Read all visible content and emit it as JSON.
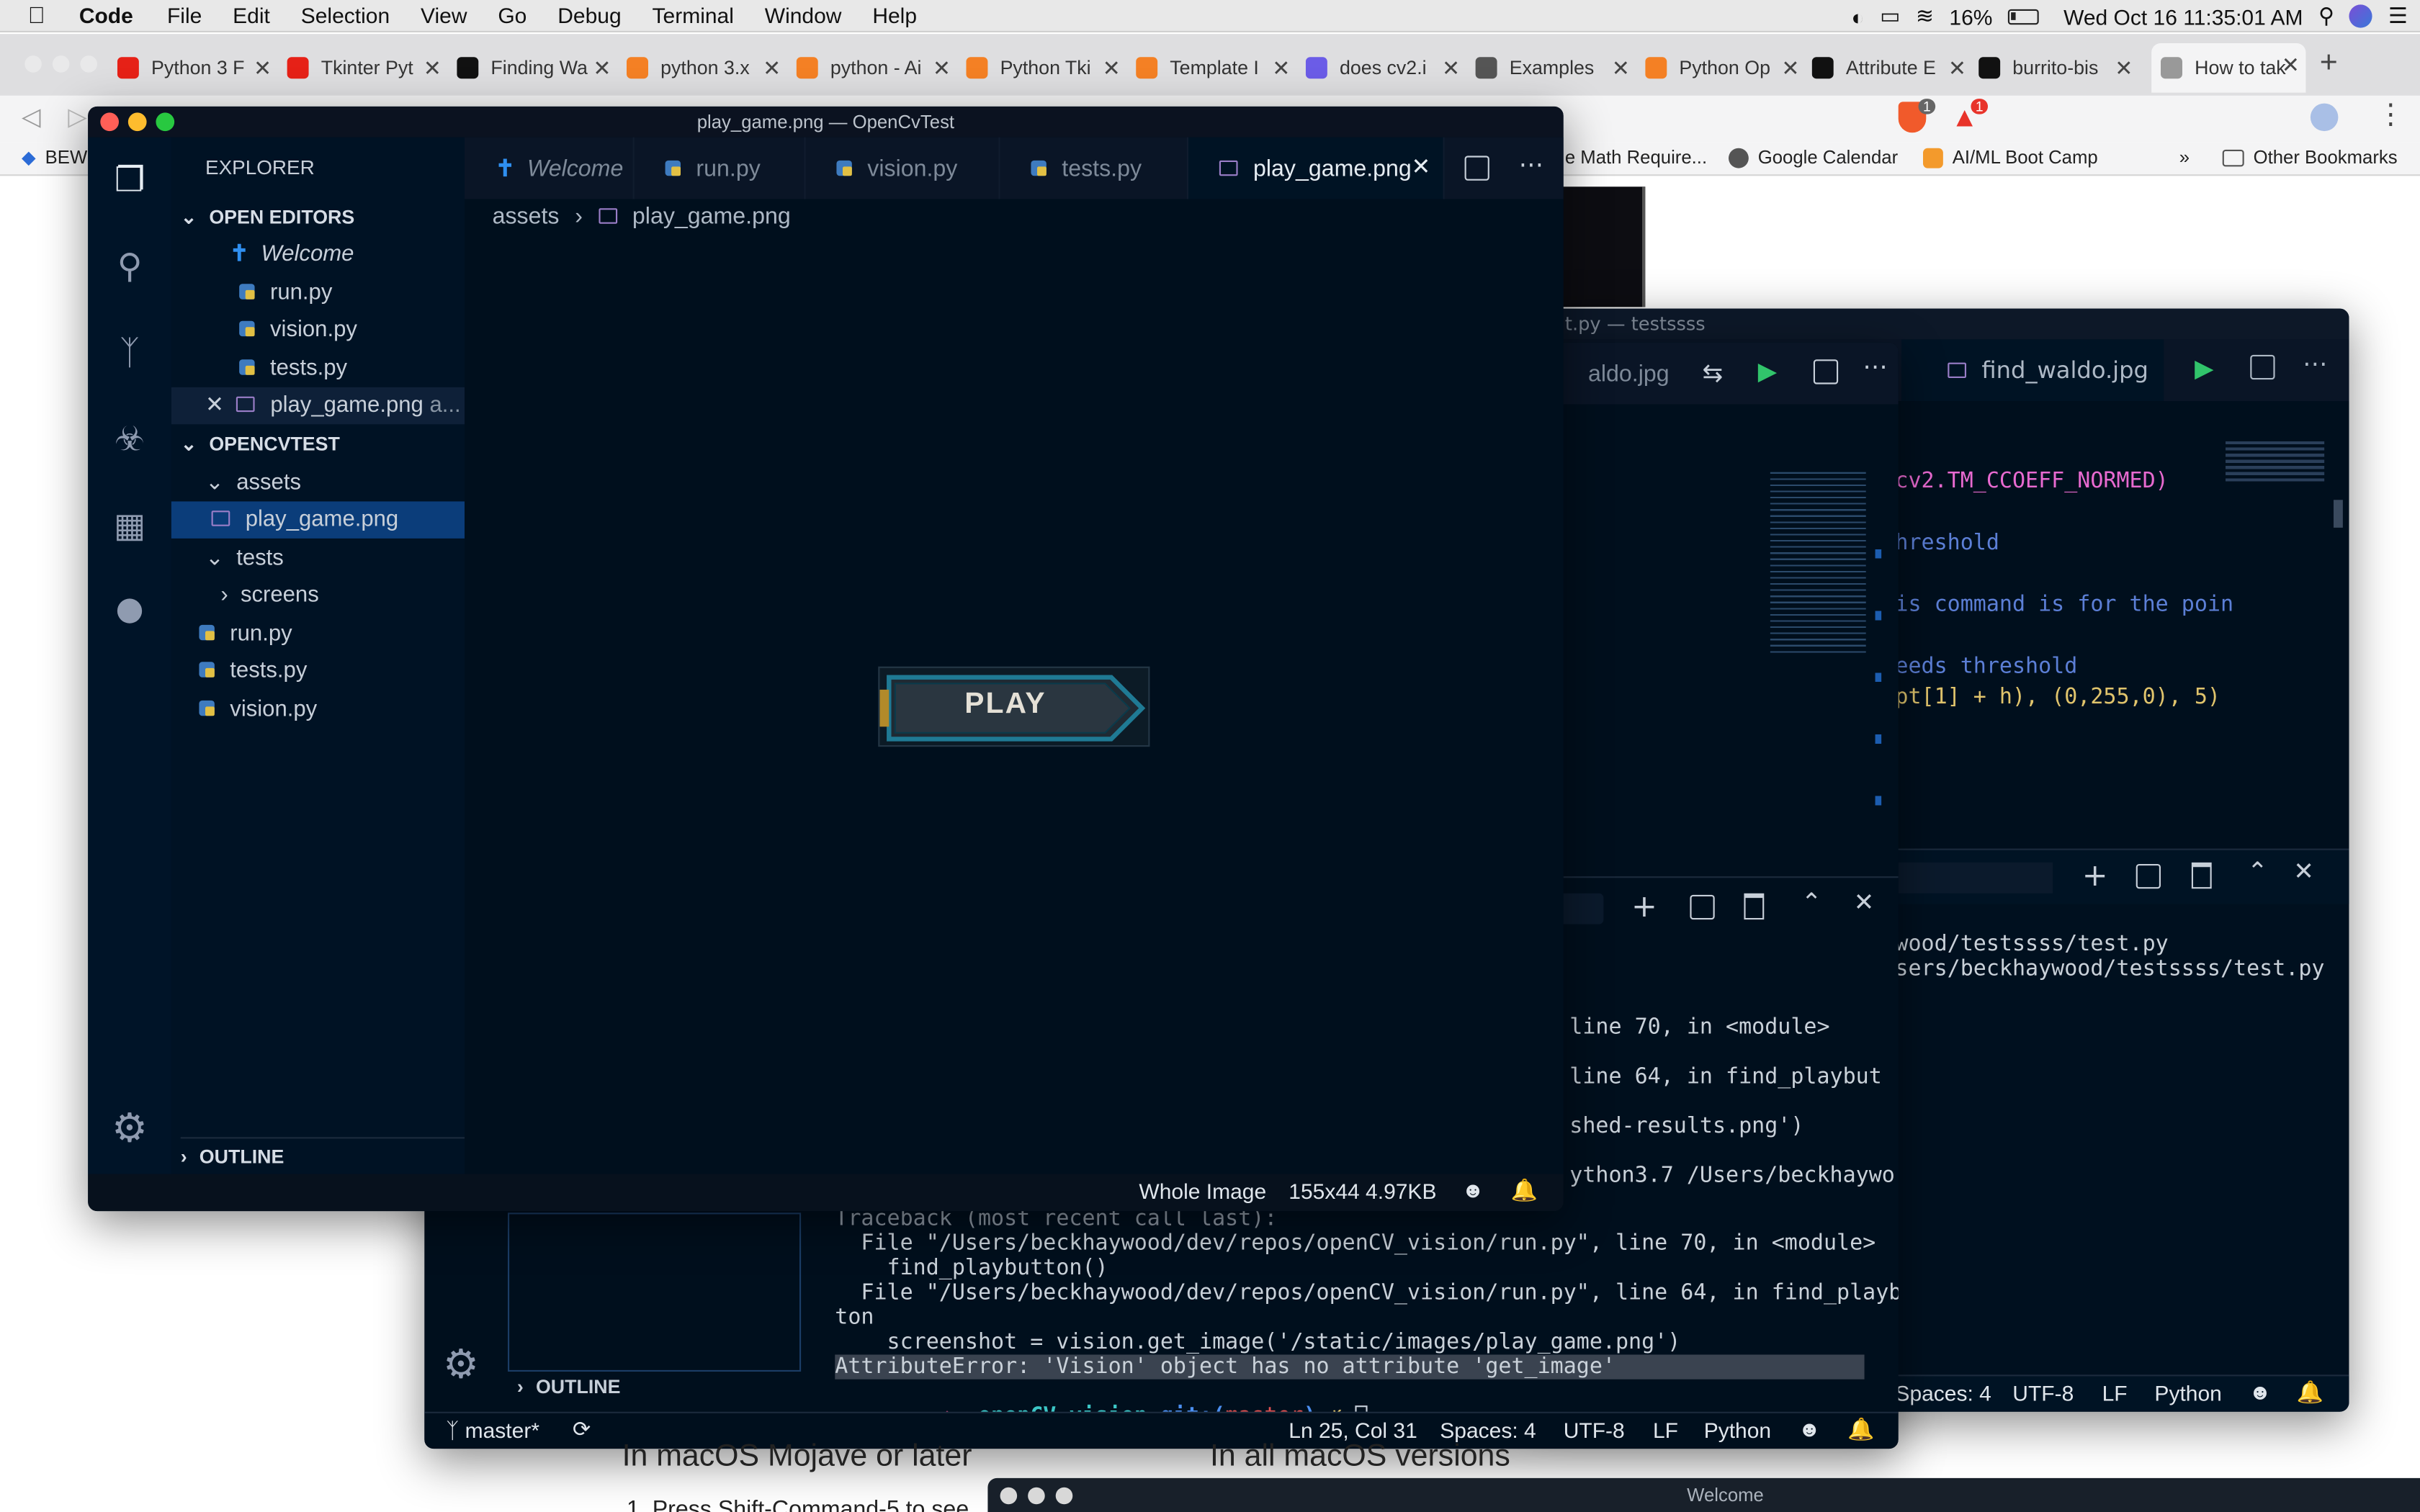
{
  "menubar": {
    "app": "Code",
    "items": [
      "File",
      "Edit",
      "Selection",
      "View",
      "Go",
      "Debug",
      "Terminal",
      "Window",
      "Help"
    ],
    "battery": "16%",
    "datetime": "Wed Oct 16  11:35:01 AM"
  },
  "browser": {
    "tabs": [
      {
        "label": "Python 3 F",
        "color": "#e62117"
      },
      {
        "label": "Tkinter Pyt",
        "color": "#e62117"
      },
      {
        "label": "Finding Wa",
        "color": "#111111"
      },
      {
        "label": "python 3.x",
        "color": "#f48024"
      },
      {
        "label": "python - Ai",
        "color": "#f48024"
      },
      {
        "label": "Python Tki",
        "color": "#f48024"
      },
      {
        "label": "Template I",
        "color": "#f48024"
      },
      {
        "label": "does cv2.i",
        "color": "#6b5ce7"
      },
      {
        "label": "Examples",
        "color": "#555555"
      },
      {
        "label": "Python Op",
        "color": "#f48024"
      },
      {
        "label": "Attribute E",
        "color": "#111111"
      },
      {
        "label": "burrito-bis",
        "color": "#111111"
      },
      {
        "label": "How to tak",
        "color": "#999999"
      }
    ],
    "new_tab": "+",
    "badges": {
      "brave": "1",
      "alert": "1"
    },
    "bookmarks": [
      "BEW",
      "e Math Require...",
      "Google Calendar",
      "AI/ML Boot Camp",
      "»",
      "Other Bookmarks"
    ]
  },
  "back_window": {
    "title": "t.py — testssss",
    "tab_left": "aldo.jpg",
    "tab_right": "find_waldo.jpg",
    "code_lines": [
      "cv2.TM_CCOEFF_NORMED)",
      "hreshold",
      "is command is for the poin",
      "eeds threshold",
      "pt[1] + h), (0,255,0), 5)"
    ],
    "terminal_lines": [
      "wood/testssss/test.py",
      "sers/beckhaywood/testssss/test.py"
    ],
    "status": {
      "spaces": "Spaces: 4",
      "encoding": "UTF-8",
      "eol": "LF",
      "lang": "Python"
    }
  },
  "middle_window": {
    "terminal_lines": [
      "line 70, in <module>",
      "line 64, in find_playbut",
      "shed-results.png')",
      "ython3.7 /Users/beckhaywo",
      "Traceback (most recent call last):",
      "  File \"/Users/beckhaywood/dev/repos/openCV_vision/run.py\", line 70, in <module>",
      "    find_playbutton()",
      "  File \"/Users/beckhaywood/dev/repos/openCV_vision/run.py\", line 64, in find_playbut",
      "ton",
      "    screenshot = vision.get_image('/static/images/play_game.png')",
      "AttributeError: 'Vision' object has no attribute 'get_image'"
    ],
    "prompt": {
      "arrow": "➜",
      "dir": "openCV_vision",
      "git": "git:(",
      "branch": "master",
      "close": ")",
      "mark": "✗"
    },
    "outline": "OUTLINE",
    "status": {
      "branch": "master*",
      "pos": "Ln 25, Col 31",
      "spaces": "Spaces: 4",
      "encoding": "UTF-8",
      "eol": "LF",
      "lang": "Python"
    },
    "page_text_left": "In macOS Mojave or later",
    "page_text_right": "In all macOS versions",
    "page_text_bottom": "1. Press Shift-Command-5 to see"
  },
  "bottom_window": {
    "title": "Welcome"
  },
  "front_window": {
    "title": "play_game.png — OpenCvTest",
    "tabs": [
      {
        "label": "Welcome",
        "kind": "vscode"
      },
      {
        "label": "run.py",
        "kind": "py"
      },
      {
        "label": "vision.py",
        "kind": "py"
      },
      {
        "label": "tests.py",
        "kind": "py"
      },
      {
        "label": "play_game.png",
        "kind": "img"
      }
    ],
    "explorer_title": "EXPLORER",
    "open_editors_title": "OPEN EDITORS",
    "open_editors": [
      {
        "label": "Welcome",
        "kind": "vscode"
      },
      {
        "label": "run.py",
        "kind": "py"
      },
      {
        "label": "vision.py",
        "kind": "py"
      },
      {
        "label": "tests.py",
        "kind": "py"
      },
      {
        "label": "play_game.png",
        "kind": "img",
        "suffix": "a..."
      }
    ],
    "project_title": "OPENCVTEST",
    "tree": [
      {
        "label": "assets",
        "indent": 1,
        "kind": "folder-open"
      },
      {
        "label": "play_game.png",
        "indent": 2,
        "kind": "img"
      },
      {
        "label": "tests",
        "indent": 1,
        "kind": "folder-open"
      },
      {
        "label": "screens",
        "indent": 2,
        "kind": "folder"
      },
      {
        "label": "run.py",
        "indent": 1,
        "kind": "py"
      },
      {
        "label": "tests.py",
        "indent": 1,
        "kind": "py"
      },
      {
        "label": "vision.py",
        "indent": 1,
        "kind": "py"
      }
    ],
    "outline": "OUTLINE",
    "breadcrumb": {
      "folder": "assets",
      "file": "play_game.png"
    },
    "image_button_label": "PLAY",
    "status": {
      "mode": "Whole Image",
      "info": "155x44  4.97KB"
    }
  }
}
